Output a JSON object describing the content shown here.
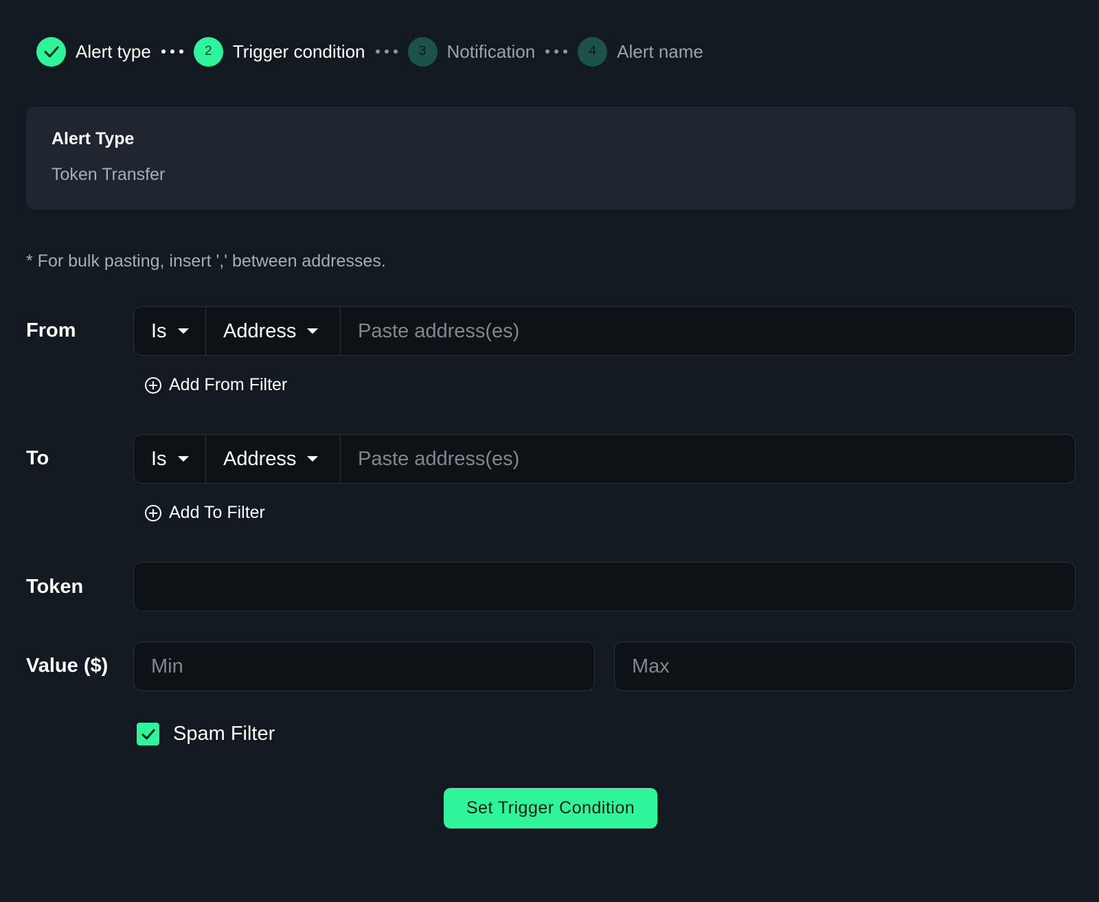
{
  "stepper": {
    "steps": [
      {
        "label": "Alert type",
        "state": "done"
      },
      {
        "number": "2",
        "label": "Trigger condition",
        "state": "active"
      },
      {
        "number": "3",
        "label": "Notification",
        "state": "pending"
      },
      {
        "number": "4",
        "label": "Alert name",
        "state": "pending"
      }
    ]
  },
  "alert_type": {
    "title": "Alert Type",
    "value": "Token Transfer"
  },
  "hint": "* For bulk pasting, insert ',' between addresses.",
  "from": {
    "label": "From",
    "operator": "Is",
    "field": "Address",
    "placeholder": "Paste address(es)",
    "add_filter": "Add From Filter"
  },
  "to": {
    "label": "To",
    "operator": "Is",
    "field": "Address",
    "placeholder": "Paste address(es)",
    "add_filter": "Add To Filter"
  },
  "token": {
    "label": "Token",
    "value": ""
  },
  "value": {
    "label": "Value ($)",
    "min_placeholder": "Min",
    "max_placeholder": "Max"
  },
  "spam_filter": {
    "label": "Spam Filter",
    "checked": true
  },
  "submit_label": "Set Trigger Condition",
  "colors": {
    "background": "#131920",
    "accent": "#2ef59a",
    "card": "#1e252e",
    "input": "#0d1217",
    "pending_step": "#1b5346"
  }
}
